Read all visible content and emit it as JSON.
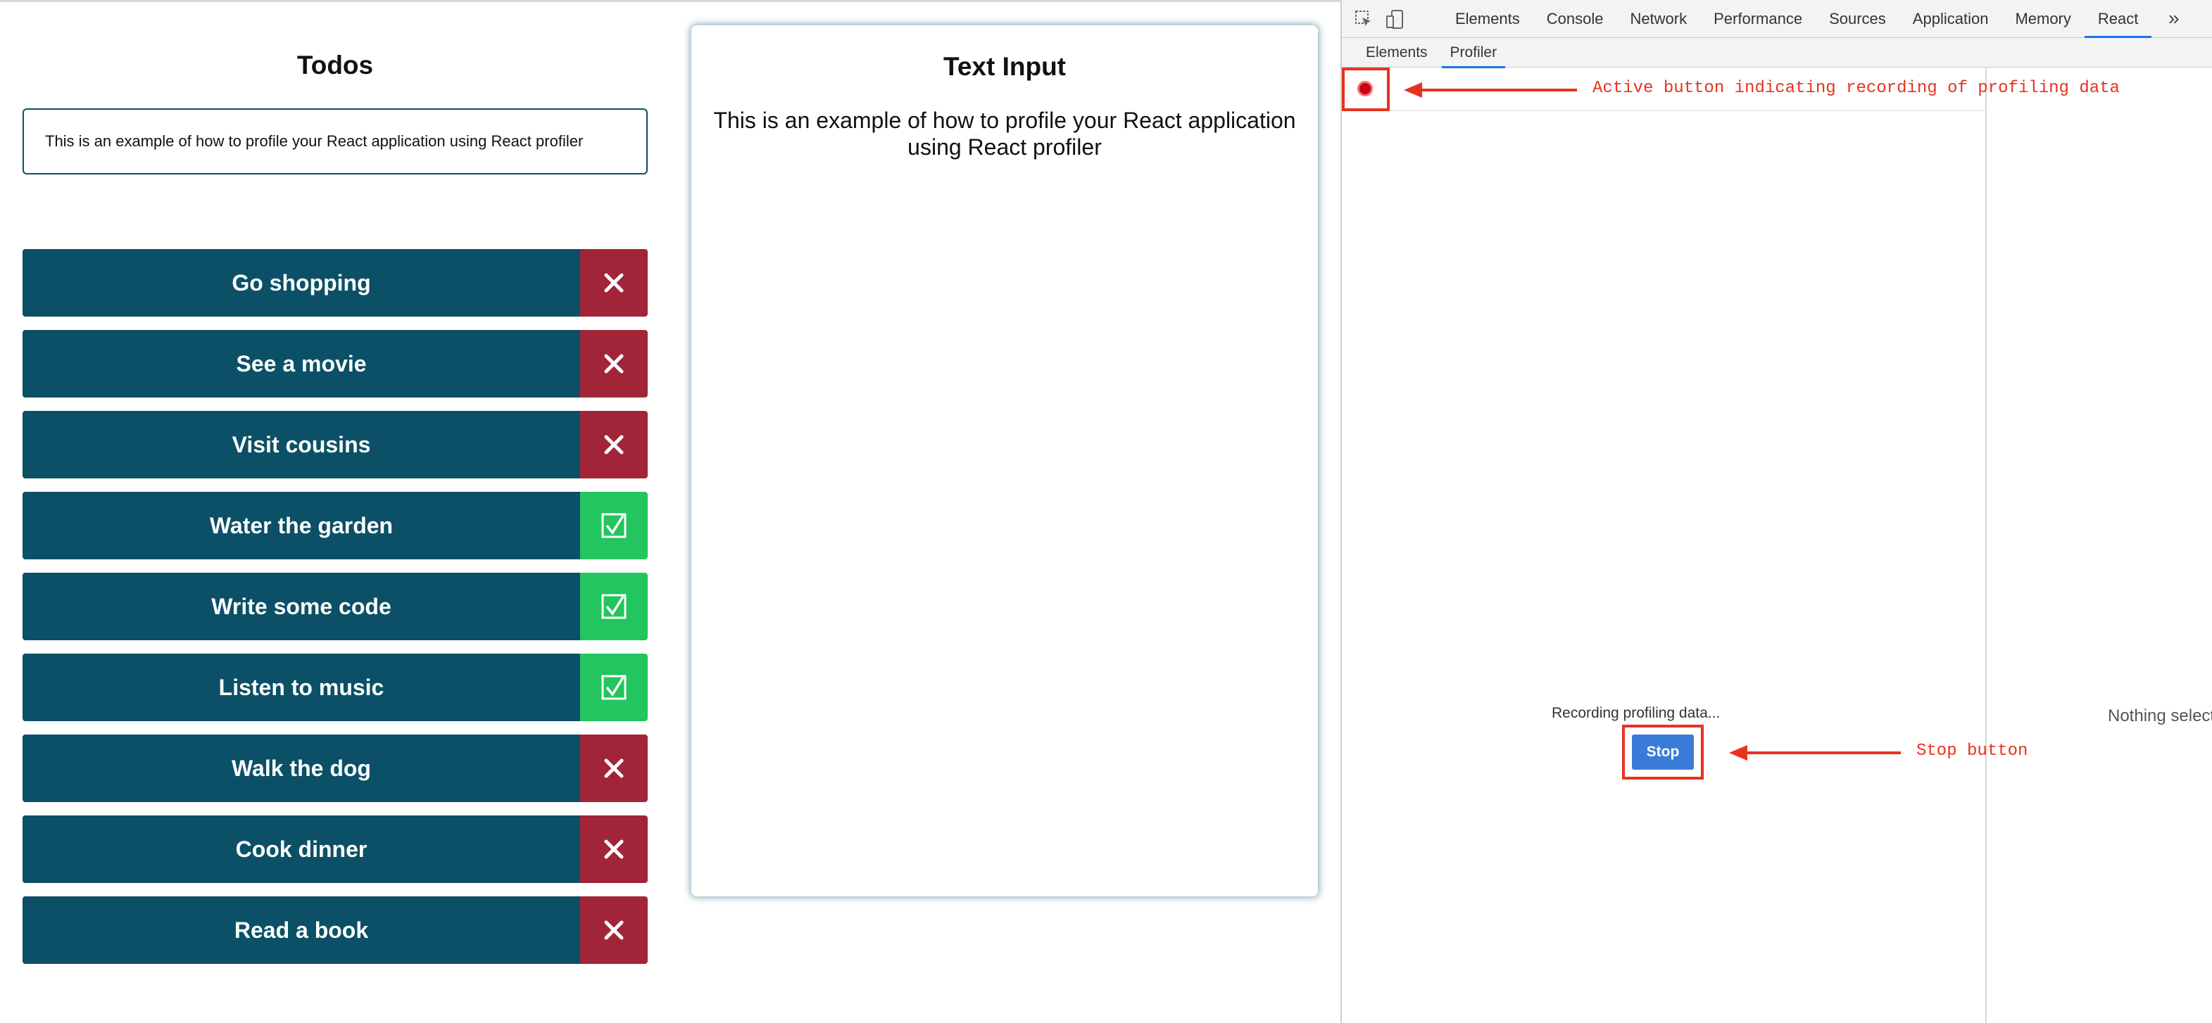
{
  "app": {
    "todos_title": "Todos",
    "input_value": "This is an example of how to profile your React application using React profiler",
    "todos": [
      {
        "label": "Go shopping",
        "status": "pending"
      },
      {
        "label": "See a movie",
        "status": "pending"
      },
      {
        "label": "Visit cousins",
        "status": "pending"
      },
      {
        "label": "Water the garden",
        "status": "done"
      },
      {
        "label": "Write some code",
        "status": "done"
      },
      {
        "label": "Listen to music",
        "status": "done"
      },
      {
        "label": "Walk the dog",
        "status": "pending"
      },
      {
        "label": "Cook dinner",
        "status": "pending"
      },
      {
        "label": "Read a book",
        "status": "pending"
      }
    ],
    "text_input_title": "Text Input",
    "text_input_body": "This is an example of how to profile your React application using React profiler",
    "colors": {
      "todo_bg": "#0b5066",
      "pending_action": "#a22439",
      "done_action": "#22c55e"
    }
  },
  "devtools": {
    "tabs": [
      "Elements",
      "Console",
      "Network",
      "Performance",
      "Sources",
      "Application",
      "Memory",
      "React"
    ],
    "active_tab": "React",
    "more_label": "»",
    "subtabs": [
      "Elements",
      "Profiler"
    ],
    "active_subtab": "Profiler",
    "recording_text": "Recording profiling data...",
    "stop_label": "Stop",
    "nothing_selected": "Nothing selected",
    "accent": "#1a73e8"
  },
  "annotations": {
    "record_note": "Active button indicating recording of profiling data",
    "stop_note": "Stop button",
    "color": "#e8321f"
  }
}
